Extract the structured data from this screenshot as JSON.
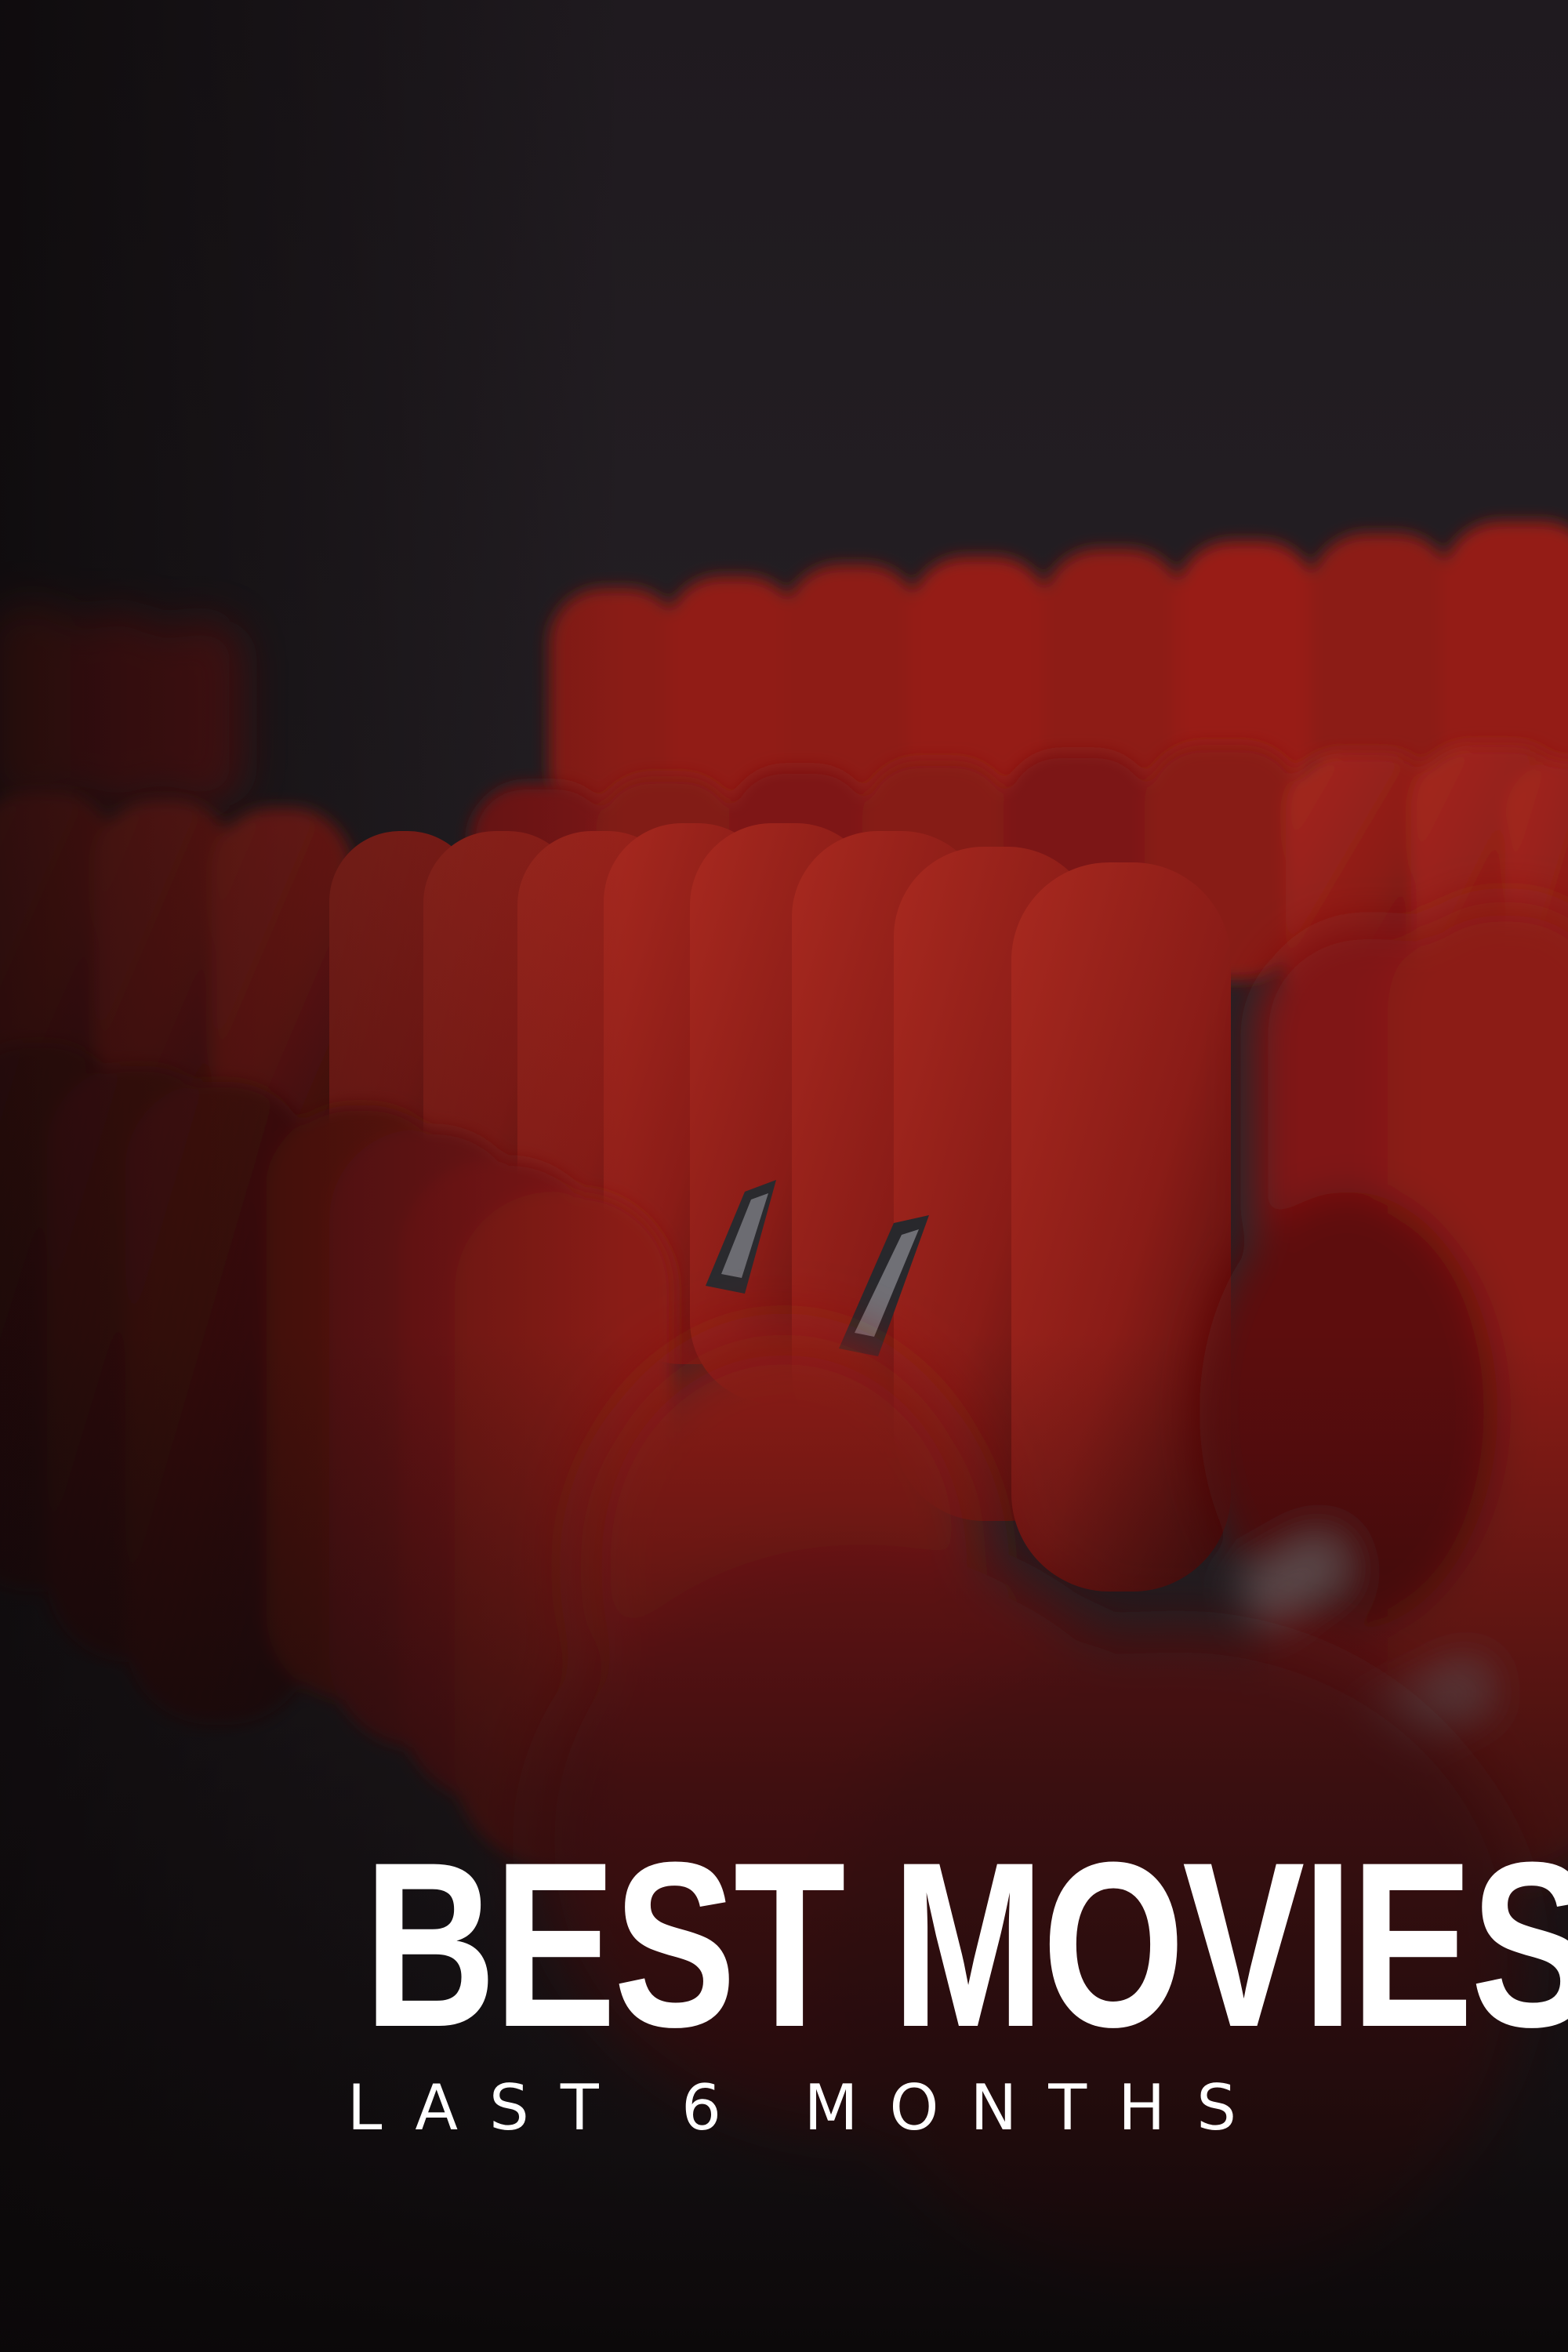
{
  "poster": {
    "title": "BEST MOVIES",
    "subtitle": "LAST 6 MONTHS"
  },
  "colors": {
    "background": "#262126",
    "seat": "#8e1d1a",
    "title_text": "#ffffff"
  }
}
